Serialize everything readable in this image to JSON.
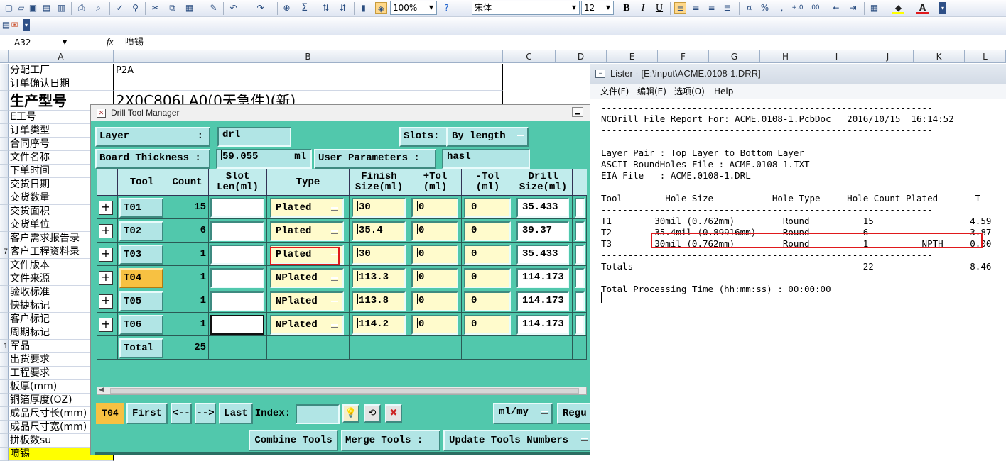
{
  "toolbar": {
    "zoom": "100%",
    "font_name": "宋体",
    "font_size": "12",
    "bold": "B",
    "italic": "I",
    "underline": "U",
    "sum_icon": "Σ",
    "percent": "%",
    "comma": ","
  },
  "formula_bar": {
    "name_box": "A32",
    "fx": "fx",
    "value": "喷锡"
  },
  "sheet": {
    "columns": [
      "A",
      "B",
      "C",
      "D",
      "E",
      "F",
      "G",
      "H",
      "I",
      "J",
      "K",
      "L"
    ],
    "row_labels": [
      "分配工厂",
      "订单确认日期",
      "生产型号",
      "E工号",
      "订单类型",
      "合同序号",
      "文件名称",
      "下单时间",
      "交货日期",
      "交货数量",
      "交货面积",
      "交货单位",
      "客户需求报告录",
      "客户工程资料录",
      "文件版本",
      "文件来源",
      "验收标准",
      "快捷标记",
      "客户标记",
      "周期标记",
      "军品",
      "出货要求",
      "工程要求",
      "板厚(mm)",
      "铜箔厚度(OZ)",
      "成品尺寸长(mm)",
      "成品尺寸宽(mm)",
      "拼板数su",
      "喷锡"
    ],
    "row_numbers": [
      "",
      "",
      "",
      "",
      "",
      "",
      "",
      "",
      "",
      "",
      "",
      "",
      "",
      "7",
      "",
      "",
      "",
      "",
      "",
      "",
      "1",
      "",
      "",
      "",
      "",
      "",
      "",
      "",
      ""
    ],
    "b_values": [
      "P2A",
      "",
      "2X0C806LA0(0天急件)(新)"
    ]
  },
  "dtm": {
    "title": "Drill Tool Manager",
    "layer_label": "Layer",
    "layer_colon": ":",
    "layer_value": "drl",
    "slots_label": "Slots:",
    "slots_value": "By length",
    "board_thickness_label": "Board Thickness :",
    "board_thickness_value": "59.055",
    "board_thickness_unit": "ml",
    "user_params_label": "User Parameters :",
    "user_params_value": "hasl",
    "headers": {
      "tool": "Tool",
      "count": "Count",
      "slot_len_1": "Slot",
      "slot_len_2": "Len(ml)",
      "type": "Type",
      "finish_1": "Finish",
      "finish_2": "Size(ml)",
      "ptol_1": "+Tol",
      "ptol_2": "(ml)",
      "mtol_1": "-Tol",
      "mtol_2": "(ml)",
      "drill_1": "Drill",
      "drill_2": "Size(ml)"
    },
    "rows": [
      {
        "tool": "T01",
        "count": "15",
        "type": "Plated",
        "finish": "30",
        "ptol": "0",
        "mtol": "0",
        "drill": "35.433"
      },
      {
        "tool": "T02",
        "count": "6",
        "type": "Plated",
        "finish": "35.4",
        "ptol": "0",
        "mtol": "0",
        "drill": "39.37"
      },
      {
        "tool": "T03",
        "count": "1",
        "type": "Plated",
        "finish": "30",
        "ptol": "0",
        "mtol": "0",
        "drill": "35.433"
      },
      {
        "tool": "T04",
        "count": "1",
        "type": "NPlated",
        "finish": "113.3",
        "ptol": "0",
        "mtol": "0",
        "drill": "114.173"
      },
      {
        "tool": "T05",
        "count": "1",
        "type": "NPlated",
        "finish": "113.8",
        "ptol": "0",
        "mtol": "0",
        "drill": "114.173"
      },
      {
        "tool": "T06",
        "count": "1",
        "type": "NPlated",
        "finish": "114.2",
        "ptol": "0",
        "mtol": "0",
        "drill": "114.173"
      }
    ],
    "total_label": "Total",
    "total_count": "25",
    "current_tool": "T04",
    "nav": {
      "first": "First",
      "prev": "<--",
      "next": "-->",
      "last": "Last",
      "index_label": "Index:"
    },
    "units_value": "ml/my",
    "regu_label": "Regu",
    "combine_tools": "Combine Tools",
    "merge_tools": "Merge Tools :",
    "update_tools": "Update Tools Numbers"
  },
  "lister": {
    "title": "Lister - [E:\\input\\ACME.0108-1.DRR]",
    "menu": [
      "文件(F)",
      "编辑(E)",
      "选项(O)",
      "Help"
    ],
    "lines": [
      "--------------------------------------------------------------",
      "NCDrill File Report For: ACME.0108-1.PcbDoc   2016/10/15  16:14:52",
      "--------------------------------------------------------------",
      "",
      "Layer Pair : Top Layer to Bottom Layer",
      "ASCII RoundHoles File : ACME.0108-1.TXT",
      "EIA File   : ACME.0108-1.DRL",
      "",
      "Tool        Hole Size           Hole Type     Hole Count Plated       T",
      "--------------------------------------------------------------",
      "T1        30mil (0.762mm)         Round          15                  4.59",
      "T2        35.4mil (0.89916mm)     Round          6                   3.87",
      "T3        30mil (0.762mm)         Round          1          NPTH     0.00",
      "--------------------------------------------------------------",
      "Totals                                           22                  8.46",
      "",
      "Total Processing Time (hh:mm:ss) : 00:00:00"
    ]
  }
}
